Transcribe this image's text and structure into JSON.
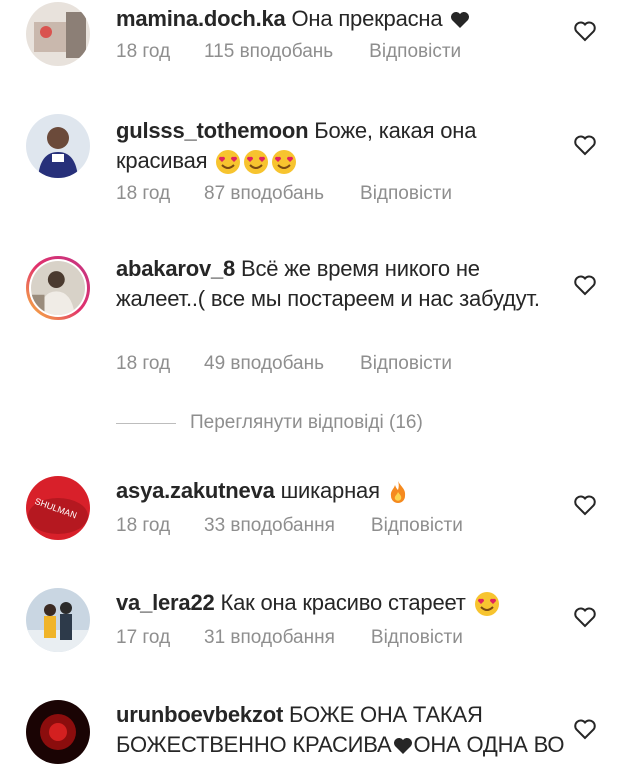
{
  "comments": [
    {
      "username": "mamina.doch.ka",
      "text": "Она прекрасна",
      "time": "18 год",
      "likes": "115 вподобань",
      "reply": "Відповісти",
      "emoji": "black-heart"
    },
    {
      "username": "gulsss_tothemoon",
      "text": "Боже, какая она красивая",
      "time": "18 год",
      "likes": "87 вподобань",
      "reply": "Відповісти",
      "emoji": "heart-eyes-x3"
    },
    {
      "username": "abakarov_8",
      "text": "Всё же время никого не жалеет..( все мы  постареем и нас забудут.",
      "time": "18 год",
      "likes": "49 вподобань",
      "reply": "Відповісти"
    },
    {
      "username": "asya.zakutneva",
      "text": "шикарная",
      "time": "18 год",
      "likes": "33 вподобання",
      "reply": "Відповісти",
      "emoji": "fire"
    },
    {
      "username": "va_lera22",
      "text": "Как она красиво стареет",
      "time": "17 год",
      "likes": "31 вподобання",
      "reply": "Відповісти",
      "emoji": "heart-eyes"
    },
    {
      "username": "urunboevbekzot",
      "text": "БОЖЕ ОНА ТАКАЯ БОЖЕСТВЕННО КРАСИВА",
      "text2": "ОНА ОДНА ВО",
      "emoji": "black-heart"
    }
  ],
  "view_replies": "Переглянути відповіді (16)"
}
